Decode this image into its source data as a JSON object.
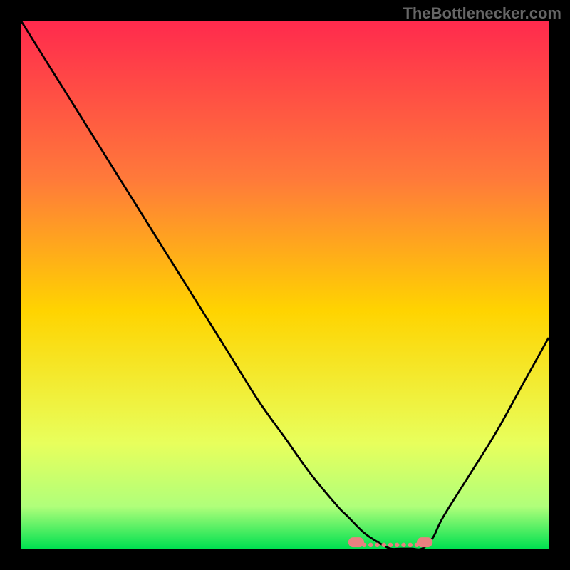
{
  "watermark": "TheBottlenecker.com",
  "chart_data": {
    "type": "line",
    "title": "",
    "xlabel": "",
    "ylabel": "",
    "xlim": [
      0,
      100
    ],
    "ylim": [
      0,
      100
    ],
    "grid": false,
    "legend": false,
    "series": [
      {
        "name": "curve",
        "x": [
          0,
          5,
          10,
          15,
          20,
          25,
          30,
          35,
          40,
          45,
          50,
          55,
          60,
          62,
          65,
          68,
          70,
          72,
          74,
          76,
          78,
          80,
          85,
          90,
          95,
          100
        ],
        "y": [
          100,
          92,
          84,
          76,
          68,
          60,
          52,
          44,
          36,
          28,
          21,
          14,
          8,
          6,
          3,
          1,
          0,
          0,
          0,
          0,
          2,
          6,
          14,
          22,
          31,
          40
        ]
      }
    ],
    "highlights": [
      {
        "x_start": 62,
        "x_end": 65,
        "y": 1.2
      },
      {
        "x_start": 75,
        "x_end": 78,
        "y": 1.2
      }
    ],
    "dotted_region": {
      "x_start": 65,
      "x_end": 75,
      "y": 0.7
    },
    "background_gradient": {
      "top": "#ff2a4d",
      "mid": "#ffd400",
      "bottom": "#00e050"
    }
  }
}
